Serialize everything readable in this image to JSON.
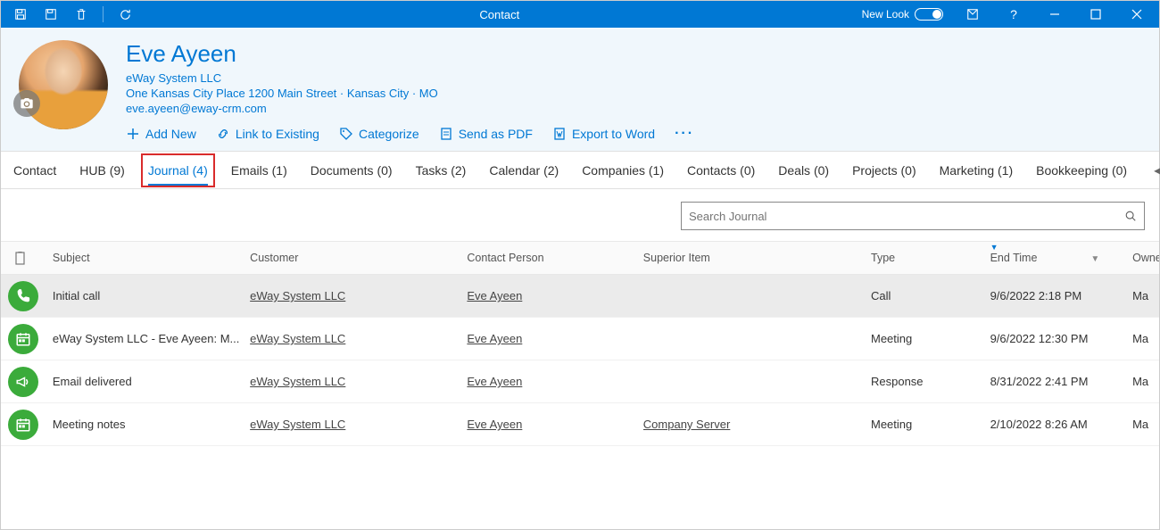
{
  "titlebar": {
    "title": "Contact",
    "newlook_label": "New Look"
  },
  "header": {
    "name": "Eve Ayeen",
    "company": "eWay System LLC",
    "address": "One Kansas City Place 1200 Main Street  ·  Kansas City  ·  MO",
    "email": "eve.ayeen@eway-crm.com",
    "actions": {
      "add_new": "Add New",
      "link_existing": "Link to Existing",
      "categorize": "Categorize",
      "send_pdf": "Send as PDF",
      "export_word": "Export to Word"
    }
  },
  "tabs": [
    {
      "label": "Contact"
    },
    {
      "label": "HUB (9)"
    },
    {
      "label": "Journal (4)",
      "active": true
    },
    {
      "label": "Emails (1)"
    },
    {
      "label": "Documents (0)"
    },
    {
      "label": "Tasks (2)"
    },
    {
      "label": "Calendar (2)"
    },
    {
      "label": "Companies (1)"
    },
    {
      "label": "Contacts (0)"
    },
    {
      "label": "Deals (0)"
    },
    {
      "label": "Projects (0)"
    },
    {
      "label": "Marketing (1)"
    },
    {
      "label": "Bookkeeping (0)"
    }
  ],
  "search": {
    "placeholder": "Search Journal"
  },
  "columns": {
    "subject": "Subject",
    "customer": "Customer",
    "contact": "Contact Person",
    "superior": "Superior Item",
    "type": "Type",
    "endtime": "End Time",
    "owner": "Owner"
  },
  "rows": [
    {
      "icon": "phone",
      "subject": "Initial call",
      "customer": "eWay System LLC",
      "contact": "Eve Ayeen",
      "superior": "",
      "type": "Call",
      "endtime": "9/6/2022 2:18 PM",
      "owner": "Ma",
      "selected": true
    },
    {
      "icon": "calendar",
      "subject": "eWay System LLC - Eve Ayeen: M...",
      "customer": "eWay System LLC",
      "contact": "Eve Ayeen",
      "superior": "",
      "type": "Meeting",
      "endtime": "9/6/2022 12:30 PM",
      "owner": "Ma"
    },
    {
      "icon": "megaphone",
      "subject": "Email delivered",
      "customer": "eWay System LLC",
      "contact": "Eve Ayeen",
      "superior": "",
      "type": "Response",
      "endtime": "8/31/2022 2:41 PM",
      "owner": "Ma"
    },
    {
      "icon": "calendar",
      "subject": "Meeting notes",
      "customer": "eWay System LLC",
      "contact": "Eve Ayeen",
      "superior": "Company Server",
      "type": "Meeting",
      "endtime": "2/10/2022 8:26 AM",
      "owner": "Ma"
    }
  ]
}
